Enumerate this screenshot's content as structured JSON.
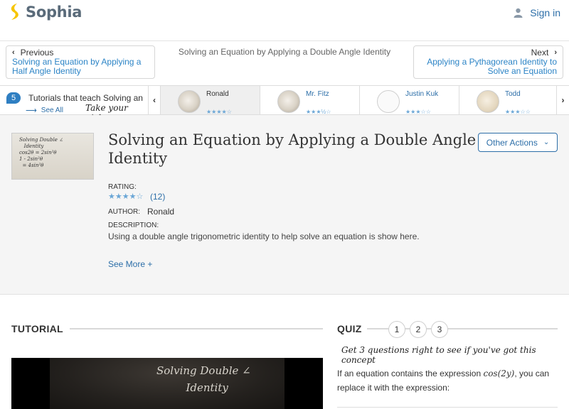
{
  "brand": {
    "name": "Sophia",
    "color": "#f6c500"
  },
  "header": {
    "signin_label": "Sign in"
  },
  "nav": {
    "prev_label": "Previous",
    "prev_title": "Solving an Equation by Applying a Half Angle Identity",
    "current_title": "Solving an Equation by Applying a Double Angle Identity",
    "next_label": "Next",
    "next_title": "Applying a Pythagorean Identity to Solve an Equation"
  },
  "strip": {
    "count": "5",
    "title": "Tutorials that teach Solving an Equation by Applying a Double Angle Identity",
    "see_all": "See All",
    "take_pick": "Take your pick:",
    "cards": [
      {
        "name": "Ronald",
        "rating_icon": "stars",
        "active": true
      },
      {
        "name": "Mr. Fitz",
        "rating_icon": "stars"
      },
      {
        "name": "Justin Kuk",
        "rating_icon": "stars"
      },
      {
        "name": "Todd",
        "rating_icon": "stars"
      }
    ]
  },
  "info": {
    "title": "Solving an Equation by Applying a Double Angle Identity",
    "other_actions": "Other Actions",
    "rating_label": "RATING:",
    "rating_stars": "★★★★☆",
    "rating_count": "(12)",
    "author_label": "AUTHOR:",
    "author": "Ronald",
    "description_label": "DESCRIPTION:",
    "description": "Using a double angle trigonometric identity to help solve an equation is show here.",
    "see_more": "See More +"
  },
  "tutorial": {
    "heading": "TUTORIAL"
  },
  "quiz": {
    "heading": "QUIZ",
    "numbers": [
      "1",
      "2",
      "3"
    ],
    "hint": "Get 3 questions right to see if you've got this concept",
    "question_pre": "If an equation contains the expression ",
    "question_math": "cos(2y)",
    "question_post": ", you can replace it with the expression:"
  },
  "card_stars": [
    "★★★★☆",
    "★★★½☆",
    "★★★☆☆",
    "★★★☆☆"
  ]
}
